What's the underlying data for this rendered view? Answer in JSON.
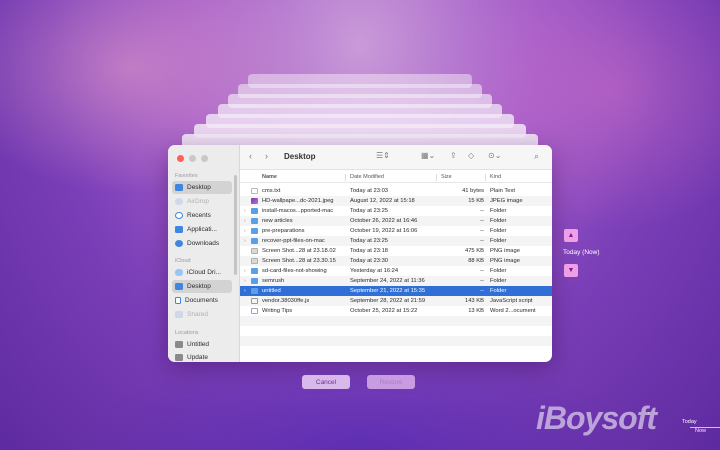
{
  "window": {
    "title": "Desktop"
  },
  "sidebar": {
    "favorites_label": "Favorites",
    "favorites": [
      {
        "label": "Desktop",
        "icon": "desktop-icon"
      },
      {
        "label": "AirDrop",
        "icon": "airdrop-icon"
      },
      {
        "label": "Recents",
        "icon": "clock-icon"
      },
      {
        "label": "Applicati...",
        "icon": "applications-icon"
      },
      {
        "label": "Downloads",
        "icon": "download-icon"
      }
    ],
    "icloud_label": "iCloud",
    "icloud": [
      {
        "label": "iCloud Dri...",
        "icon": "cloud-icon"
      },
      {
        "label": "Desktop",
        "icon": "desktop-icon"
      },
      {
        "label": "Documents",
        "icon": "document-icon"
      },
      {
        "label": "Shared",
        "icon": "shared-icon"
      }
    ],
    "locations_label": "Locations",
    "locations": [
      {
        "label": "Untitled",
        "icon": "disk-icon"
      },
      {
        "label": "Update",
        "icon": "disk-icon"
      }
    ]
  },
  "columns": {
    "name": "Name",
    "date": "Date Modified",
    "size": "Size",
    "kind": "Kind"
  },
  "files": [
    {
      "chev": "",
      "icon": "file",
      "name": "cms.txt",
      "date": "Today at 23:03",
      "size": "41 bytes",
      "kind": "Plain Text"
    },
    {
      "chev": "",
      "icon": "wall",
      "name": "HD-wallpape...dc-2021.jpeg",
      "date": "August 12, 2022 at 15:18",
      "size": "15 KB",
      "kind": "JPEG image"
    },
    {
      "chev": "›",
      "icon": "folder",
      "name": "install-macos...pported-mac",
      "date": "Today at 23:25",
      "size": "--",
      "kind": "Folder"
    },
    {
      "chev": "›",
      "icon": "folder",
      "name": "new articles",
      "date": "October 26, 2022 at 16:46",
      "size": "--",
      "kind": "Folder"
    },
    {
      "chev": "›",
      "icon": "folder",
      "name": "pre-preparations",
      "date": "October 19, 2022 at 16:06",
      "size": "--",
      "kind": "Folder"
    },
    {
      "chev": "›",
      "icon": "folder",
      "name": "recover-ppt-files-on-mac",
      "date": "Today at 23:25",
      "size": "--",
      "kind": "Folder"
    },
    {
      "chev": "",
      "icon": "img",
      "name": "Screen Shot...28 at 23.18.02",
      "date": "Today at 23:18",
      "size": "475 KB",
      "kind": "PNG image"
    },
    {
      "chev": "",
      "icon": "img",
      "name": "Screen Shot...28 at 23.30.15",
      "date": "Today at 23:30",
      "size": "88 KB",
      "kind": "PNG image"
    },
    {
      "chev": "›",
      "icon": "folder",
      "name": "sd-card-files-not-showing",
      "date": "Yesterday at 16:24",
      "size": "--",
      "kind": "Folder"
    },
    {
      "chev": "›",
      "icon": "folder",
      "name": "semrush",
      "date": "September 24, 2022 at 11:36",
      "size": "--",
      "kind": "Folder"
    },
    {
      "chev": "›",
      "icon": "folder",
      "name": "untitled",
      "date": "September 21, 2022 at 15:35",
      "size": "--",
      "kind": "Folder",
      "selected": true
    },
    {
      "chev": "",
      "icon": "js",
      "name": "vendor.38030ffe.js",
      "date": "September 28, 2022 at 21:59",
      "size": "143 KB",
      "kind": "JavaScript script"
    },
    {
      "chev": "",
      "icon": "doc",
      "name": "Writing Tips",
      "date": "October 25, 2022 at 15:22",
      "size": "13 KB",
      "kind": "Word 2...ocument"
    }
  ],
  "buttons": {
    "cancel": "Cancel",
    "restore": "Restore"
  },
  "timemachine": {
    "label": "Today (Now)",
    "timeline_a": "Today",
    "timeline_b": "Now"
  },
  "watermark": "iBoysoft",
  "colors": {
    "selection": "#2f6fd6",
    "folder": "#5aa0e6",
    "accent_pink": "#ef9fe6"
  }
}
